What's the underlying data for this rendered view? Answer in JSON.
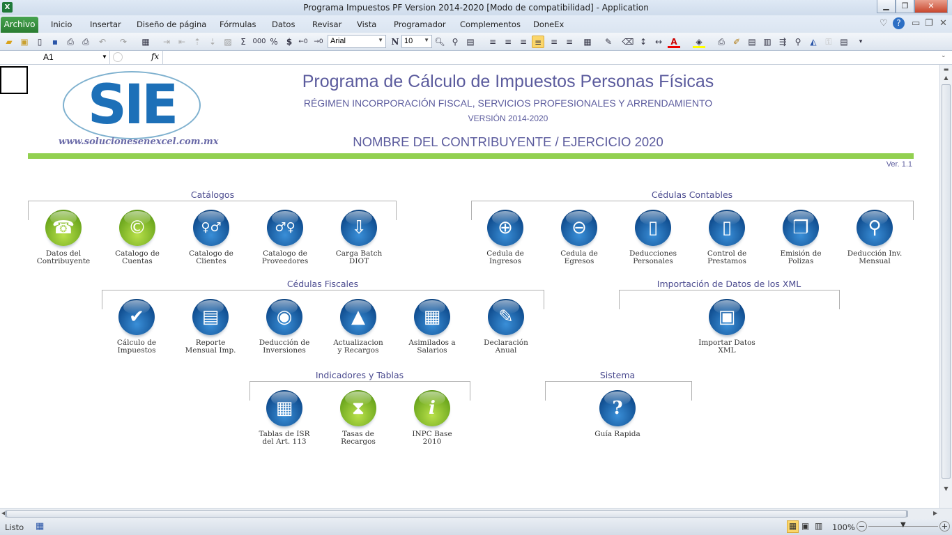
{
  "window": {
    "title": "Programa Impuestos PF Version 2014-2020  [Modo de compatibilidad]  -  Application",
    "app_icon": "excel-icon"
  },
  "menu": {
    "tabs": [
      "Archivo",
      "Inicio",
      "Insertar",
      "Diseño de página",
      "Fórmulas",
      "Datos",
      "Revisar",
      "Vista",
      "Programador",
      "Complementos",
      "DoneEx"
    ]
  },
  "toolbar": {
    "font": "Arial",
    "font_size": "10",
    "bold_label": "N",
    "thousands": "000",
    "percent": "%",
    "currency": "$",
    "sum": "Σ"
  },
  "formula_bar": {
    "name_box": "A1",
    "fx": "fx",
    "formula": ""
  },
  "header": {
    "logo_text": "SIE",
    "logo_url": "www.solucionesenexcel.com.mx",
    "title": "Programa de Cálculo de Impuestos Personas Físicas",
    "subtitle": "RÉGIMEN INCORPORACIÓN FISCAL, SERVICIOS PROFESIONALES Y ARRENDAMIENTO",
    "version_range": "VERSIÓN 2014-2020",
    "taxpayer": "NOMBRE DEL CONTRIBUYENTE / EJERCICIO 2020",
    "version": "Ver. 1.1"
  },
  "colors": {
    "accent_green": "#92d050",
    "blue": "#0f4c8e",
    "green": "#6aa51c"
  },
  "sections": [
    {
      "title": "Catálogos",
      "items": [
        {
          "label": "Datos del\nContribuyente",
          "icon": "telephone-icon",
          "glyph": "☎",
          "color": "green"
        },
        {
          "label": "Catalogo de\nCuentas",
          "icon": "copyright-icon",
          "glyph": "©",
          "color": "green"
        },
        {
          "label": "Catalogo de\nClientes",
          "icon": "people-icon",
          "glyph": "♀♂",
          "color": "blue"
        },
        {
          "label": "Catalogo de\nProveedores",
          "icon": "walking-people-icon",
          "glyph": "♂♀",
          "color": "blue"
        },
        {
          "label": "Carga Batch\nDIOT",
          "icon": "floppy-download-icon",
          "glyph": "⇩",
          "color": "blue"
        }
      ]
    },
    {
      "title": "Cédulas Contables",
      "items": [
        {
          "label": "Cedula de\nIngresos",
          "icon": "plus-icon",
          "glyph": "⊕",
          "color": "blue"
        },
        {
          "label": "Cedula de\nEgresos",
          "icon": "minus-icon",
          "glyph": "⊖",
          "color": "blue"
        },
        {
          "label": "Deducciones\nPersonales",
          "icon": "document-minus-icon",
          "glyph": "▯",
          "color": "blue"
        },
        {
          "label": "Control de\nPrestamos",
          "icon": "document-plus-icon",
          "glyph": "▯",
          "color": "blue"
        },
        {
          "label": "Emisión de\nPolizas",
          "icon": "copy-documents-icon",
          "glyph": "❐",
          "color": "blue"
        },
        {
          "label": "Deducción Inv.\nMensual",
          "icon": "pushpin-icon",
          "glyph": "⚲",
          "color": "blue"
        }
      ]
    },
    {
      "title": "Cédulas Fiscales",
      "items": [
        {
          "label": "Cálculo de\nImpuestos",
          "icon": "checkmark-icon",
          "glyph": "✔",
          "color": "blue"
        },
        {
          "label": "Reporte\nMensual Imp.",
          "icon": "report-icon",
          "glyph": "▤",
          "color": "blue"
        },
        {
          "label": "Deducción de\nInversiones",
          "icon": "camera-icon",
          "glyph": "◉",
          "color": "blue"
        },
        {
          "label": "Actualizacion\ny Recargos",
          "icon": "triangle-a-icon",
          "glyph": "▲",
          "color": "blue"
        },
        {
          "label": "Asimilados a\nSalarios",
          "icon": "calculator-icon",
          "glyph": "▦",
          "color": "blue"
        },
        {
          "label": "Declaración\nAnual",
          "icon": "brush-icon",
          "glyph": "✎",
          "color": "blue"
        }
      ]
    },
    {
      "title": "Importación de Datos de los XML",
      "items": [
        {
          "label": "Importar Datos\nXML",
          "icon": "import-xml-icon",
          "glyph": "▣",
          "color": "blue"
        }
      ]
    },
    {
      "title": "Indicadores y Tablas",
      "items": [
        {
          "label": "Tablas de ISR\ndel Art. 113",
          "icon": "table-grid-icon",
          "glyph": "▦",
          "color": "blue"
        },
        {
          "label": "Tasas de\nRecargos",
          "icon": "hourglass-icon",
          "glyph": "⧗",
          "color": "green"
        },
        {
          "label": "INPC Base\n2010",
          "icon": "info-icon",
          "glyph": "i",
          "color": "green"
        }
      ]
    },
    {
      "title": "Sistema",
      "items": [
        {
          "label": "Guía Rapida",
          "icon": "help-icon",
          "glyph": "?",
          "color": "blue"
        }
      ]
    }
  ],
  "status": {
    "ready": "Listo",
    "zoom": "100%"
  }
}
